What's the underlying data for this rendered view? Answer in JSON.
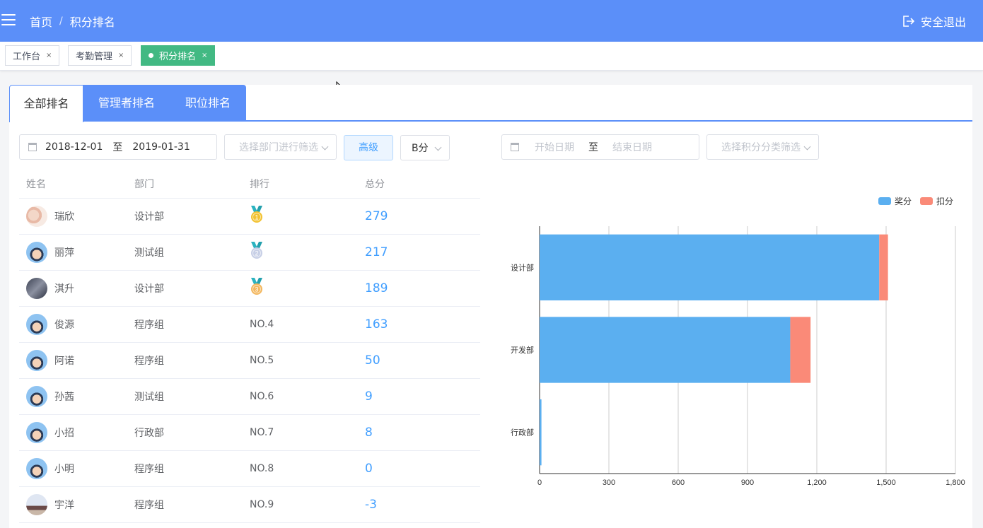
{
  "header": {
    "home": "首页",
    "separator": "/",
    "current": "积分排名",
    "logout": "安全退出"
  },
  "tags": [
    {
      "label": "工作台",
      "close": "×"
    },
    {
      "label": "考勤管理",
      "close": "×"
    },
    {
      "label": "积分排名",
      "close": "×"
    }
  ],
  "tabs": [
    "全部排名",
    "管理者排名",
    "职位排名"
  ],
  "filters": {
    "start_date": "2018-12-01",
    "to": "至",
    "end_date": "2019-01-31",
    "dept_placeholder": "选择部门进行筛选",
    "advanced": "高级",
    "score_type": "B分",
    "start_placeholder": "开始日期",
    "to2": "至",
    "end_placeholder": "结束日期",
    "category_placeholder": "选择积分分类筛选"
  },
  "table": {
    "headers": [
      "姓名",
      "部门",
      "排行",
      "总分"
    ],
    "rows": [
      {
        "name": "瑞欣",
        "dept": "设计部",
        "rank": "",
        "medal": "1",
        "score": "279"
      },
      {
        "name": "丽萍",
        "dept": "测试组",
        "rank": "",
        "medal": "2",
        "score": "217"
      },
      {
        "name": "淇升",
        "dept": "设计部",
        "rank": "",
        "medal": "3",
        "score": "189"
      },
      {
        "name": "俊源",
        "dept": "程序组",
        "rank": "NO.4",
        "medal": "",
        "score": "163"
      },
      {
        "name": "阿诺",
        "dept": "程序组",
        "rank": "NO.5",
        "medal": "",
        "score": "50"
      },
      {
        "name": "孙茜",
        "dept": "测试组",
        "rank": "NO.6",
        "medal": "",
        "score": "9"
      },
      {
        "name": "小招",
        "dept": "行政部",
        "rank": "NO.7",
        "medal": "",
        "score": "8"
      },
      {
        "name": "小明",
        "dept": "程序组",
        "rank": "NO.8",
        "medal": "",
        "score": "0"
      },
      {
        "name": "宇洋",
        "dept": "程序组",
        "rank": "NO.9",
        "medal": "",
        "score": "-3"
      }
    ]
  },
  "colors": {
    "primary": "#5b8ff9",
    "active_tag": "#42b983",
    "reward": "#5baff0",
    "deduct": "#fa8a78"
  },
  "chart_data": {
    "type": "bar",
    "orientation": "horizontal",
    "stacked": true,
    "categories": [
      "设计部",
      "开发部",
      "行政部"
    ],
    "series": [
      {
        "name": "奖分",
        "values": [
          1470,
          1085,
          8
        ]
      },
      {
        "name": "扣分",
        "values": [
          38,
          88,
          0
        ]
      }
    ],
    "xlim": [
      0,
      1800
    ],
    "xticks": [
      "0",
      "300",
      "600",
      "900",
      "1,200",
      "1,500",
      "1,800"
    ],
    "legend": "top-right",
    "grid": true
  }
}
